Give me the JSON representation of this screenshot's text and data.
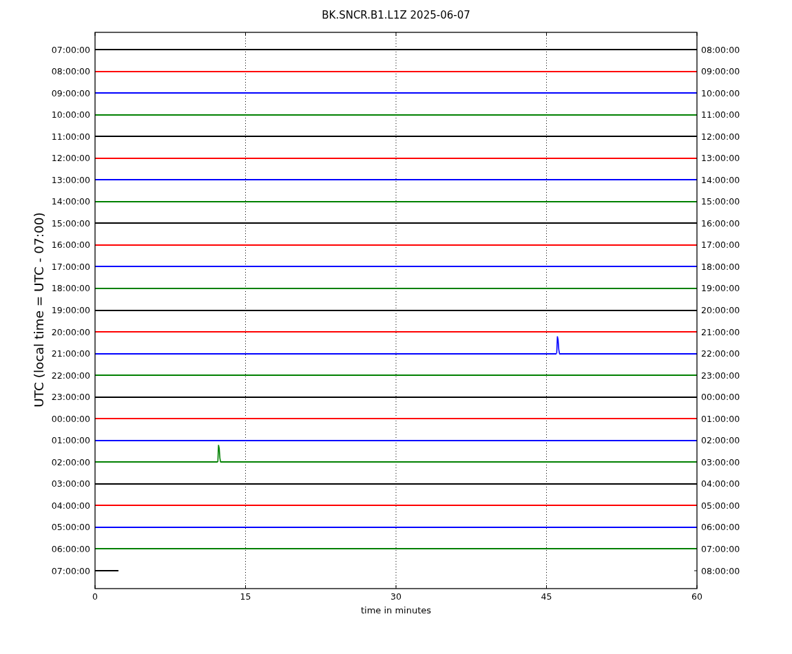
{
  "title": "BK.SNCR.B1.L1Z 2025-06-07",
  "ylabel": "UTC (local time = UTC - 07:00)",
  "xlabel": "time in minutes",
  "xticks": [
    "0",
    "15",
    "30",
    "45",
    "60"
  ],
  "rows": [
    {
      "left": "07:00:00",
      "right": "08:00:00",
      "color": "#000000",
      "kind": "quiet"
    },
    {
      "left": "08:00:00",
      "right": "09:00:00",
      "color": "#ff0000",
      "kind": "quiet"
    },
    {
      "left": "09:00:00",
      "right": "10:00:00",
      "color": "#0000ff",
      "kind": "quiet"
    },
    {
      "left": "10:00:00",
      "right": "11:00:00",
      "color": "#008000",
      "kind": "quiet"
    },
    {
      "left": "11:00:00",
      "right": "12:00:00",
      "color": "#000000",
      "kind": "quiet"
    },
    {
      "left": "12:00:00",
      "right": "13:00:00",
      "color": "#ff0000",
      "kind": "quiet"
    },
    {
      "left": "13:00:00",
      "right": "14:00:00",
      "color": "#0000ff",
      "kind": "quiet"
    },
    {
      "left": "14:00:00",
      "right": "15:00:00",
      "color": "#008000",
      "kind": "quiet"
    },
    {
      "left": "15:00:00",
      "right": "16:00:00",
      "color": "#000000",
      "kind": "quiet"
    },
    {
      "left": "16:00:00",
      "right": "17:00:00",
      "color": "#ff0000",
      "kind": "quiet"
    },
    {
      "left": "17:00:00",
      "right": "18:00:00",
      "color": "#0000ff",
      "kind": "quiet"
    },
    {
      "left": "18:00:00",
      "right": "19:00:00",
      "color": "#008000",
      "kind": "quiet"
    },
    {
      "left": "19:00:00",
      "right": "20:00:00",
      "color": "#000000",
      "kind": "quiet"
    },
    {
      "left": "20:00:00",
      "right": "21:00:00",
      "color": "#ff0000",
      "kind": "quiet"
    },
    {
      "left": "21:00:00",
      "right": "22:00:00",
      "color": "#0000ff",
      "kind": "event",
      "level": 0.767
    },
    {
      "left": "22:00:00",
      "right": "23:00:00",
      "color": "#008000",
      "kind": "quiet"
    },
    {
      "left": "23:00:00",
      "right": "00:00:00",
      "color": "#000000",
      "kind": "quiet"
    },
    {
      "left": "00:00:00",
      "right": "01:00:00",
      "color": "#ff0000",
      "kind": "quiet"
    },
    {
      "left": "01:00:00",
      "right": "02:00:00",
      "color": "#0000ff",
      "kind": "quiet"
    },
    {
      "left": "02:00:00",
      "right": "03:00:00",
      "color": "#008000",
      "kind": "event",
      "level": 0.204
    },
    {
      "left": "03:00:00",
      "right": "04:00:00",
      "color": "#000000",
      "kind": "quiet"
    },
    {
      "left": "04:00:00",
      "right": "05:00:00",
      "color": "#ff0000",
      "kind": "quiet"
    },
    {
      "left": "05:00:00",
      "right": "06:00:00",
      "color": "#0000ff",
      "kind": "quiet"
    },
    {
      "left": "06:00:00",
      "right": "07:00:00",
      "color": "#008000",
      "kind": "quiet"
    },
    {
      "left": "07:00:00",
      "right": "08:00:00",
      "color": "#000000",
      "kind": "partial",
      "level": 0.039
    }
  ]
}
